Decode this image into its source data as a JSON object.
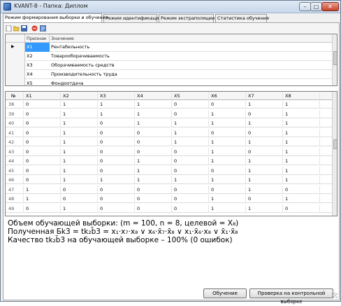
{
  "window": {
    "title": "KVANT-8 - Папка: Диплом",
    "min": "–",
    "max": "□",
    "close": "✕"
  },
  "tabs": [
    {
      "label": "Режим формирования выборки и обучения"
    },
    {
      "label": "Режим идентификации"
    },
    {
      "label": "Режим экстраполяции"
    },
    {
      "label": "Статистика обучения"
    }
  ],
  "toolbar": {
    "icons": [
      "new-icon",
      "open-icon",
      "save-icon",
      "stop-icon",
      "export-icon"
    ]
  },
  "features_grid": {
    "headers": [
      "Признак",
      "Значение"
    ],
    "rows": [
      {
        "id": "X1",
        "value": "Рентабельность",
        "selected": true
      },
      {
        "id": "X2",
        "value": "Товарооборачиваемость"
      },
      {
        "id": "X3",
        "value": "Оборачиваемость средств"
      },
      {
        "id": "X4",
        "value": "Производительность труда"
      },
      {
        "id": "X5",
        "value": "Фондоотдача"
      }
    ]
  },
  "data_grid": {
    "headers": [
      "№",
      "X1",
      "X2",
      "X3",
      "X4",
      "X5",
      "X6",
      "X7",
      "X8"
    ],
    "rows": [
      [
        "38",
        "0",
        "1",
        "1",
        "1",
        "0",
        "0",
        "1",
        "1"
      ],
      [
        "39",
        "0",
        "1",
        "1",
        "1",
        "0",
        "1",
        "0",
        "1"
      ],
      [
        "40",
        "0",
        "1",
        "0",
        "1",
        "1",
        "1",
        "1",
        "1"
      ],
      [
        "41",
        "0",
        "1",
        "0",
        "0",
        "1",
        "0",
        "0",
        "1"
      ],
      [
        "42",
        "0",
        "1",
        "0",
        "0",
        "1",
        "1",
        "1",
        "1"
      ],
      [
        "43",
        "0",
        "1",
        "0",
        "0",
        "0",
        "1",
        "0",
        "1"
      ],
      [
        "44",
        "0",
        "1",
        "0",
        "1",
        "0",
        "1",
        "1",
        "1"
      ],
      [
        "45",
        "0",
        "1",
        "0",
        "1",
        "0",
        "0",
        "1",
        "1"
      ],
      [
        "46",
        "0",
        "1",
        "1",
        "1",
        "1",
        "1",
        "1",
        "1"
      ],
      [
        "47",
        "1",
        "0",
        "0",
        "0",
        "0",
        "0",
        "1",
        "0"
      ],
      [
        "48",
        "1",
        "0",
        "0",
        "0",
        "0",
        "1",
        "0",
        "1"
      ],
      [
        "49",
        "0",
        "1",
        "0",
        "0",
        "0",
        "1",
        "1",
        "0"
      ]
    ]
  },
  "output": {
    "line1": "Объем обучающей выборки: (m = 100, n = 8, целевой = X₈)",
    "line2": "Полученная Бk3 = tk₂b̄3 = x₁·x₇·x₈ ∨ x₆·x̄₇·x̄₈ ∨ x₁·x̄₆·x₈ ∨ x̄₁·x̄₈",
    "line3": "Качество tk₂b̄3 на обучающей выборке – 100% (0 ошибок)"
  },
  "buttons": {
    "train": "Обучение",
    "check": "Проверка на контрольной выборке"
  }
}
